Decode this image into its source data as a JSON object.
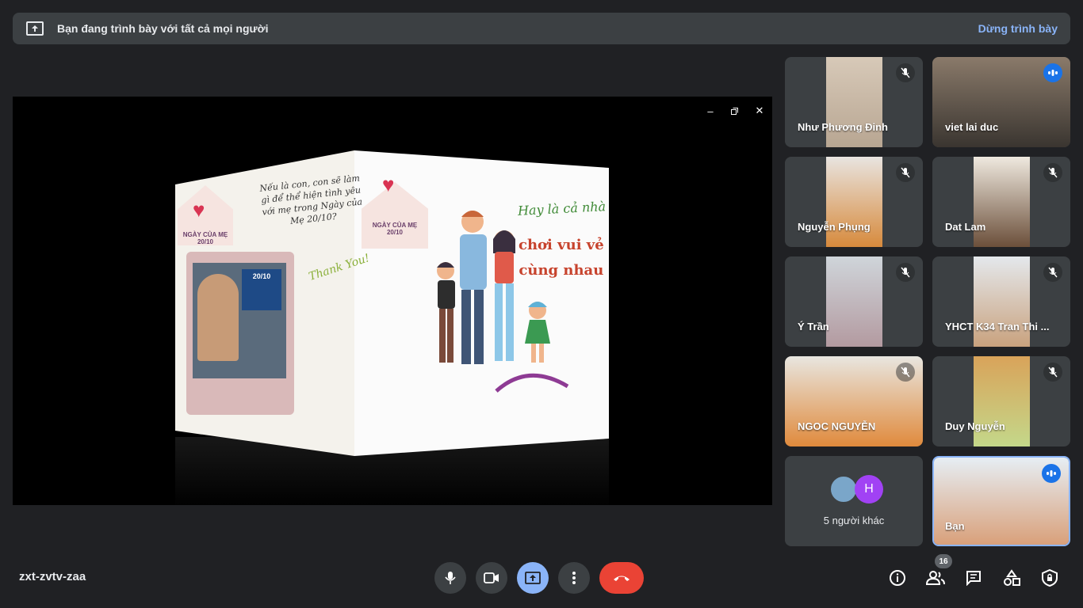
{
  "banner": {
    "text": "Bạn đang trình bày với tất cả mọi người",
    "stop_label": "Dừng trình bày"
  },
  "slide": {
    "left_question": "Nếu là con, con sẽ làm gì để thể hiện tình yêu với mẹ trong Ngày của Mẹ 20/10?",
    "thank_you": "Thank You!",
    "house_label": "NGÀY CỦA MẸ 20/10",
    "tv_text": "20/10",
    "right_line1": "Hay là cả nhà",
    "right_line2": "chơi vui vẻ",
    "right_line3": "cùng nhau"
  },
  "participants": [
    {
      "name": "Như Phương Đinh",
      "mic": "muted"
    },
    {
      "name": "viet lai duc",
      "mic": "speaking"
    },
    {
      "name": "Nguyễn Phụng",
      "mic": "muted"
    },
    {
      "name": "Dat Lam",
      "mic": "muted"
    },
    {
      "name": "Ý Trần",
      "mic": "muted"
    },
    {
      "name": "YHCT K34 Tran Thi ...",
      "mic": "muted"
    },
    {
      "name": "NGOC NGUYỄN",
      "mic": "muted"
    },
    {
      "name": "Duy Nguyễn",
      "mic": "muted"
    },
    {
      "name": "Bạn",
      "mic": "speaking"
    }
  ],
  "others": {
    "label": "5 người khác",
    "avatar_letter": "H"
  },
  "footer": {
    "meeting_code": "zxt-zvtv-zaa",
    "participant_count": "16"
  },
  "colors": {
    "accent": "#8ab4f8",
    "hangup": "#ea4335",
    "speaking": "#1a73e8",
    "background": "#202124"
  }
}
